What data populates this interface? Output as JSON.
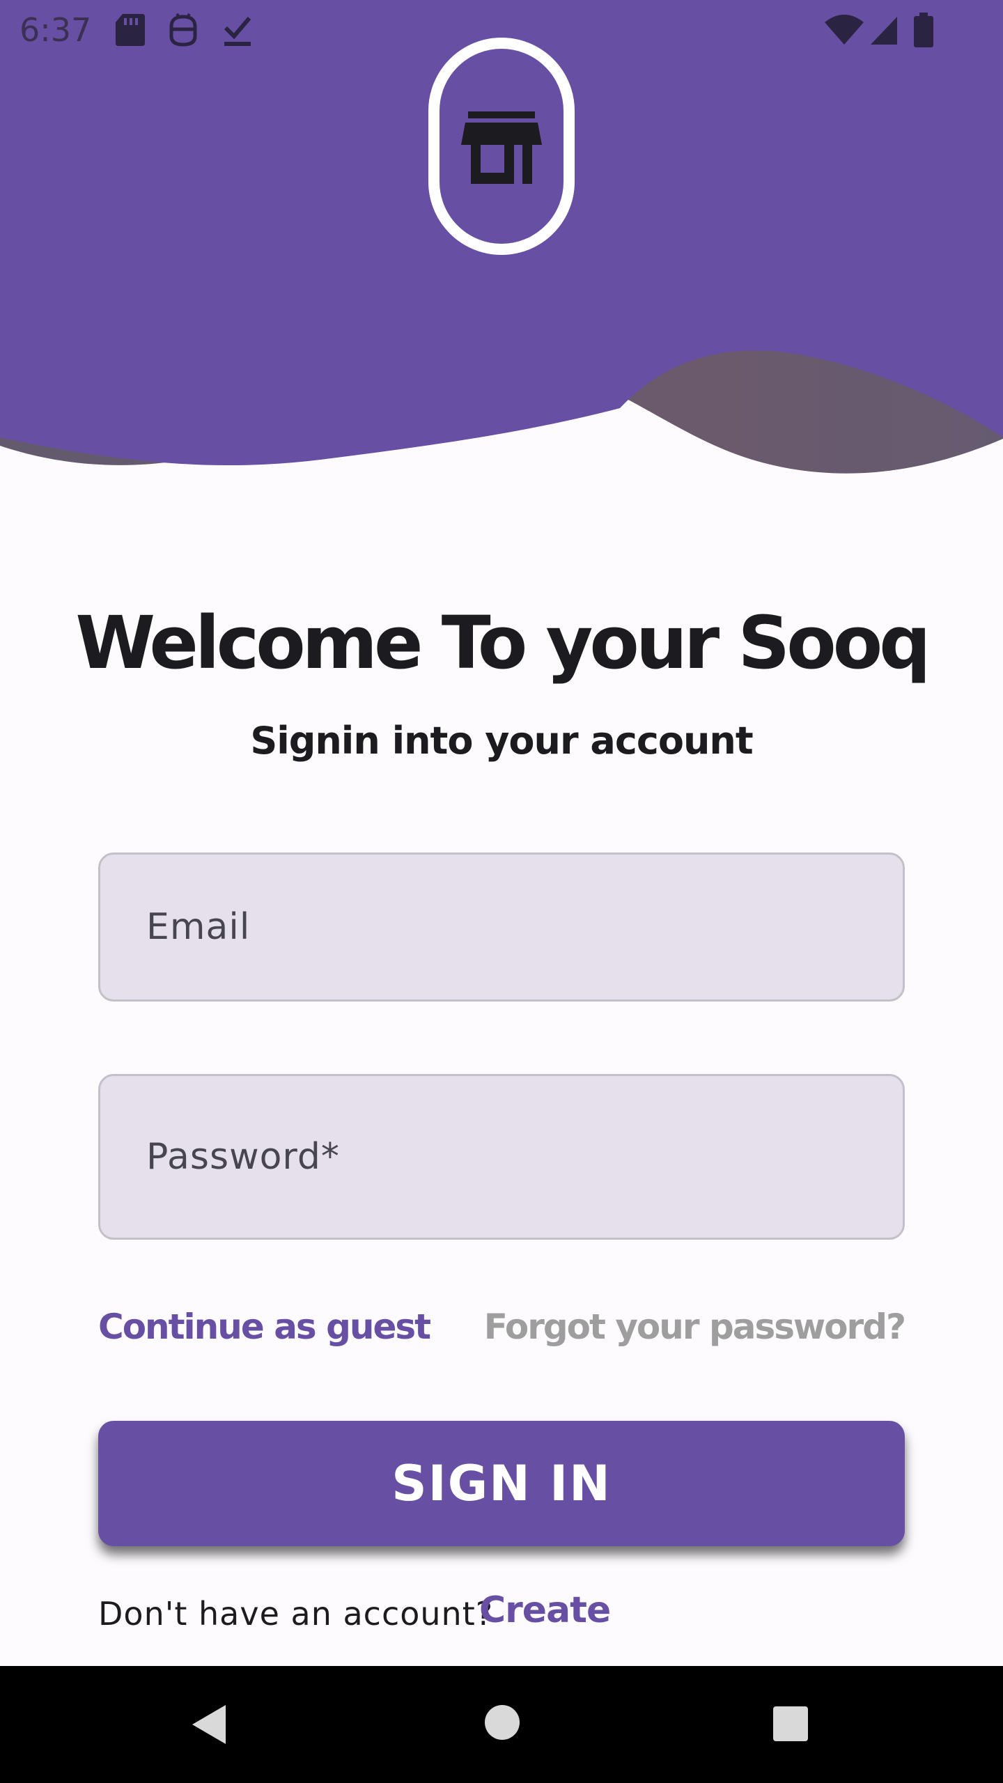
{
  "status_bar": {
    "time": "6:37",
    "left_icons": [
      "sd-card-icon",
      "robot-icon",
      "download-check-icon"
    ],
    "right_icons": [
      "wifi-icon",
      "cell-signal-icon",
      "battery-icon"
    ]
  },
  "header": {
    "logo_icon": "store-icon",
    "colors": {
      "primary": "#6750a4",
      "wave_shadow": "#665d6f"
    }
  },
  "welcome": {
    "title": "Welcome To your Sooq",
    "subtitle": "Signin into your account"
  },
  "form": {
    "email_placeholder": "Email",
    "password_placeholder": "Password*"
  },
  "links": {
    "guest": "Continue as guest",
    "forgot": "Forgot your password?"
  },
  "signin_button": {
    "label": "SIGN IN"
  },
  "account": {
    "prompt": "Don't have an account?",
    "create": "Create"
  },
  "nav_bar": {
    "buttons": [
      "back-icon",
      "home-icon",
      "recents-icon"
    ]
  }
}
